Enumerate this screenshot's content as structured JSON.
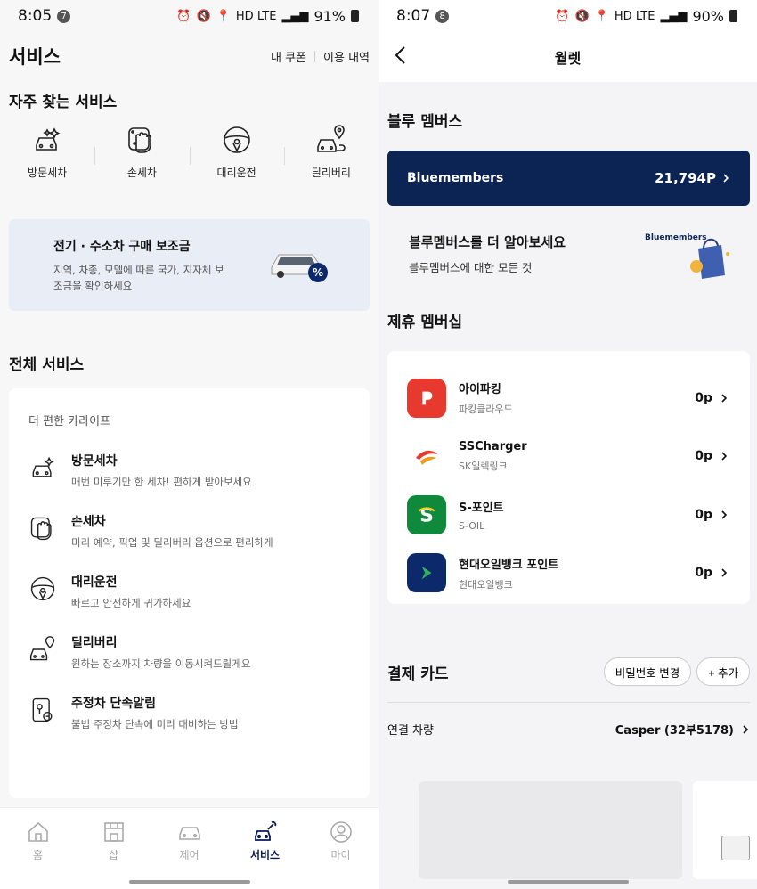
{
  "left": {
    "status": {
      "time": "8:05",
      "notif_count": "7",
      "battery": "91%",
      "net": "HD LTE"
    },
    "header": {
      "title": "서비스",
      "link_coupon": "내 쿠폰",
      "link_history": "이용 내역"
    },
    "frequent": {
      "title": "자주 찾는 서비스",
      "items": [
        {
          "label": "방문세차",
          "icon": "car-wash-visit-icon"
        },
        {
          "label": "손세차",
          "icon": "hand-wash-icon"
        },
        {
          "label": "대리운전",
          "icon": "steering-wheel-icon"
        },
        {
          "label": "딜리버리",
          "icon": "delivery-pin-icon"
        }
      ]
    },
    "promo": {
      "title": "전기 · 수소차 구매 보조금",
      "desc": "지역, 차종, 모델에 따른 국가, 지자체 보조금을 확인하세요",
      "badge": "%"
    },
    "all": {
      "title": "전체 서비스",
      "subtitle": "더 편한 카라이프",
      "items": [
        {
          "name": "방문세차",
          "desc": "매번 미루기만 한 세차! 편하게 받아보세요"
        },
        {
          "name": "손세차",
          "desc": "미리 예약, 픽업 및 딜리버리 옵션으로 편리하게"
        },
        {
          "name": "대리운전",
          "desc": "빠르고 안전하게 귀가하세요"
        },
        {
          "name": "딜리버리",
          "desc": "원하는 장소까지 차량을 이동시켜드릴게요"
        },
        {
          "name": "주정차 단속알림",
          "desc": "불법 주정차 단속에 미리 대비하는 방법"
        }
      ]
    },
    "tabs": [
      {
        "label": "홈",
        "active": false
      },
      {
        "label": "샵",
        "active": false
      },
      {
        "label": "제어",
        "active": false
      },
      {
        "label": "서비스",
        "active": true
      },
      {
        "label": "마이",
        "active": false
      }
    ]
  },
  "right": {
    "status": {
      "time": "8:07",
      "notif_count": "8",
      "battery": "90%",
      "net": "HD LTE"
    },
    "header": {
      "title": "월렛"
    },
    "bluemembers": {
      "title": "블루 멤버스",
      "logo": "Bluemembers",
      "points": "21,794P",
      "info_title": "블루멤버스를 더 알아보세요",
      "info_desc": "블루멤버스에 대한 모든 것",
      "bag_logo": "Bluemembers"
    },
    "partners": {
      "title": "제휴 멤버십",
      "items": [
        {
          "name": "아이파킹",
          "sub": "파킹클라우드",
          "points": "0p",
          "color": "#e8392f"
        },
        {
          "name": "SSCharger",
          "sub": "SK일렉링크",
          "points": "0p",
          "color": "#ffffff"
        },
        {
          "name": "S-포인트",
          "sub": "S-OIL",
          "points": "0p",
          "color": "#0f8a3c"
        },
        {
          "name": "현대오일뱅크 포인트",
          "sub": "현대오일뱅크",
          "points": "0p",
          "color": "#0c2a6b"
        }
      ]
    },
    "payment": {
      "title": "결제 카드",
      "btn_password": "비밀번호 변경",
      "btn_add": "+ 추가",
      "vehicle_label": "연결 차량",
      "vehicle_value": "Casper (32부5178)"
    }
  },
  "colors": {
    "navy": "#0c2453",
    "accent": "#0a1a55",
    "promo_bg": "#e9edf6"
  }
}
